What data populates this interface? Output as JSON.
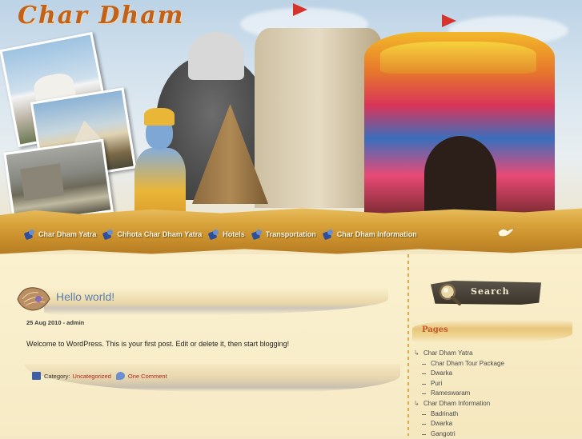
{
  "header": {
    "site_title": "Char Dham"
  },
  "nav": {
    "items": [
      {
        "label": "Char Dham Yatra",
        "icon": "pen-icon"
      },
      {
        "label": "Chhota Char Dham Yatra",
        "icon": "pen-icon"
      },
      {
        "label": "Hotels",
        "icon": "pen-icon"
      },
      {
        "label": "Transportation",
        "icon": "pen-icon"
      },
      {
        "label": "Char Dham Information",
        "icon": "pen-icon"
      }
    ]
  },
  "post": {
    "title": "Hello world!",
    "meta": "25 Aug 2010 - admin",
    "body": "Welcome to WordPress. This is your first post. Edit or delete it, then start blogging!",
    "category_label": "Category:",
    "category_link": "Uncategorized",
    "comments_link": "One Comment"
  },
  "sidebar": {
    "search_label": "Search",
    "pages_title": "Pages",
    "pages": [
      {
        "label": "Char Dham Yatra",
        "level": 1
      },
      {
        "label": "Char Dham Tour Package",
        "level": 2
      },
      {
        "label": "Dwarka",
        "level": 2
      },
      {
        "label": "Puri",
        "level": 2
      },
      {
        "label": "Rameswaram",
        "level": 2
      },
      {
        "label": "Char Dham Information",
        "level": 1
      },
      {
        "label": "Badrinath",
        "level": 2
      },
      {
        "label": "Dwarka",
        "level": 2
      },
      {
        "label": "Gangotri",
        "level": 2
      }
    ]
  },
  "colors": {
    "title_orange": "#c2611a",
    "link_blue": "#5b7fb1",
    "link_red": "#b3261e",
    "nav_gold": "#d9a33b",
    "page_bg": "#fbf1cf"
  }
}
